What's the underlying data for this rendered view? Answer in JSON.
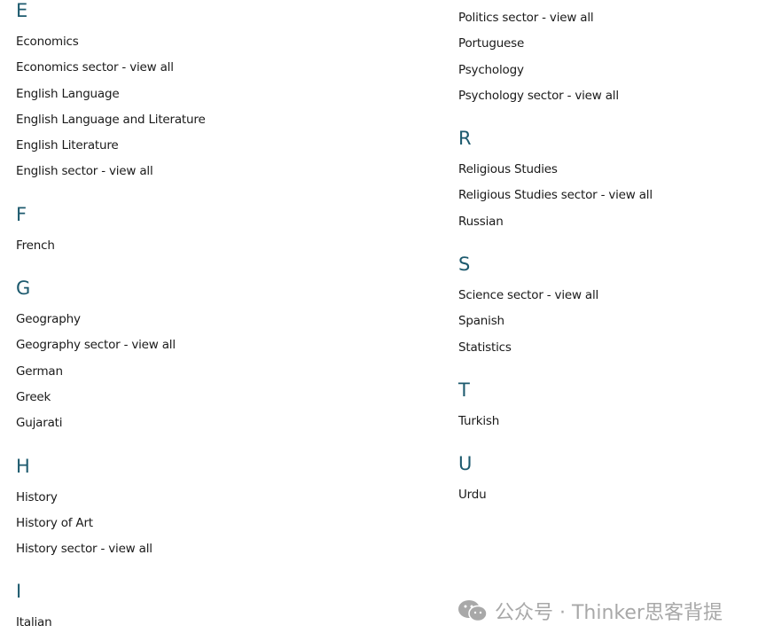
{
  "left_column": [
    {
      "letter": "E",
      "items": [
        "Economics",
        "Economics sector - view all",
        "English Language",
        "English Language and Literature",
        "English Literature",
        "English sector - view all"
      ]
    },
    {
      "letter": "F",
      "items": [
        "French"
      ]
    },
    {
      "letter": "G",
      "items": [
        "Geography",
        "Geography sector - view all",
        "German",
        "Greek",
        "Gujarati"
      ]
    },
    {
      "letter": "H",
      "items": [
        "History",
        "History of Art",
        "History sector - view all"
      ]
    },
    {
      "letter": "I",
      "items": [
        "Italian"
      ]
    }
  ],
  "right_column": [
    {
      "letter": "",
      "items": [
        "Politics sector - view all",
        "Portuguese",
        "Psychology",
        "Psychology sector - view all"
      ]
    },
    {
      "letter": "R",
      "items": [
        "Religious Studies",
        "Religious Studies sector - view all",
        "Russian"
      ]
    },
    {
      "letter": "S",
      "items": [
        "Science sector - view all",
        "Spanish",
        "Statistics"
      ]
    },
    {
      "letter": "T",
      "items": [
        "Turkish"
      ]
    },
    {
      "letter": "U",
      "items": [
        "Urdu"
      ]
    }
  ],
  "watermark": {
    "text": "公众号 · Thinker思客背提",
    "icon": "wechat-icon"
  },
  "colors": {
    "heading": "#1d5a6e",
    "text": "#1a1a1a",
    "watermark": "#a8a8a8"
  }
}
